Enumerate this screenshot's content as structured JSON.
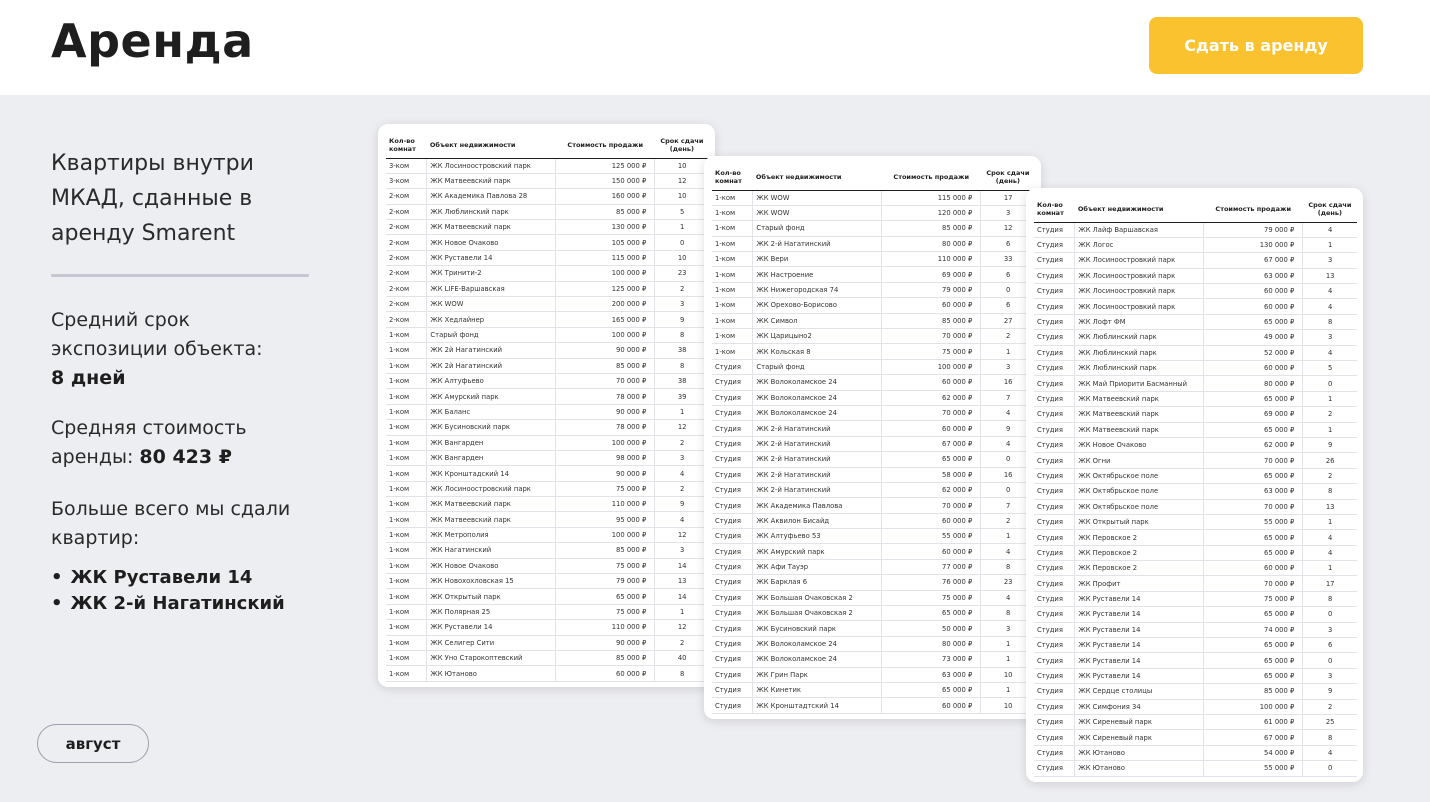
{
  "header": {
    "title": "Аренда",
    "cta_label": "Сдать в аренду"
  },
  "colors": {
    "accent": "#f9c22e",
    "background": "#edeef2",
    "text": "#1e1e1e"
  },
  "sidebar": {
    "headline": "Квартиры внутри МКАД, сданные в аренду Smarent",
    "exposure_label": "Средний срок экспозиции объекта:",
    "exposure_value": "8 дней",
    "avg_price_label": "Средняя стоимость аренды:",
    "avg_price_value": "80 423 ₽",
    "most_rented_label": "Больше всего мы сдали квартир:",
    "most_rented": [
      "ЖК Руставели 14",
      "ЖК 2-й Нагатинский"
    ],
    "month": "август"
  },
  "table_headers": [
    "Кол-во комнат",
    "Объект недвижимости",
    "Стоимость продажи",
    "Срок сдачи (день)"
  ],
  "tables": [
    [
      [
        "3-ком",
        "ЖК Лосиноостровский парк",
        "125 000 ₽",
        "10"
      ],
      [
        "3-ком",
        "ЖК Матвеевский парк",
        "150 000 ₽",
        "12"
      ],
      [
        "2-ком",
        "ЖК Академика Павлова 28",
        "160 000 ₽",
        "10"
      ],
      [
        "2-ком",
        "ЖК Люблинский парк",
        "85 000 ₽",
        "5"
      ],
      [
        "2-ком",
        "ЖК Матвеевский парк",
        "130 000 ₽",
        "1"
      ],
      [
        "2-ком",
        "ЖК Новое Очаково",
        "105 000 ₽",
        "0"
      ],
      [
        "2-ком",
        "ЖК Руставели 14",
        "115 000 ₽",
        "10"
      ],
      [
        "2-ком",
        "ЖК Тринити-2",
        "100 000 ₽",
        "23"
      ],
      [
        "2-ком",
        "ЖК LIFE-Варшавская",
        "125 000 ₽",
        "2"
      ],
      [
        "2-ком",
        "ЖК WOW",
        "200 000 ₽",
        "3"
      ],
      [
        "2-ком",
        "ЖК Хедлайнер",
        "165 000 ₽",
        "9"
      ],
      [
        "1-ком",
        "Старый фонд",
        "100 000 ₽",
        "8"
      ],
      [
        "1-ком",
        "ЖК 2й Нагатинский",
        "90 000 ₽",
        "38"
      ],
      [
        "1-ком",
        "ЖК 2й Нагатинский",
        "85 000 ₽",
        "8"
      ],
      [
        "1-ком",
        "ЖК Алтуфьево",
        "70 000 ₽",
        "38"
      ],
      [
        "1-ком",
        "ЖК Амурский парк",
        "78 000 ₽",
        "39"
      ],
      [
        "1-ком",
        "ЖК Баланс",
        "90 000 ₽",
        "1"
      ],
      [
        "1-ком",
        "ЖК Бусиновский парк",
        "78 000 ₽",
        "12"
      ],
      [
        "1-ком",
        "ЖК Вангарден",
        "100 000 ₽",
        "2"
      ],
      [
        "1-ком",
        "ЖК Вангарден",
        "98 000 ₽",
        "3"
      ],
      [
        "1-ком",
        "ЖК Кронштадский 14",
        "90 000 ₽",
        "4"
      ],
      [
        "1-ком",
        "ЖК Лосиноостровский парк",
        "75 000 ₽",
        "2"
      ],
      [
        "1-ком",
        "ЖК Матвеевский парк",
        "110 000 ₽",
        "9"
      ],
      [
        "1-ком",
        "ЖК Матвеевский парк",
        "95 000 ₽",
        "4"
      ],
      [
        "1-ком",
        "ЖК Метрополия",
        "100 000 ₽",
        "12"
      ],
      [
        "1-ком",
        "ЖК Нагатинский",
        "85 000 ₽",
        "3"
      ],
      [
        "1-ком",
        "ЖК Новое Очаково",
        "75 000 ₽",
        "14"
      ],
      [
        "1-ком",
        "ЖК Новохохловская 15",
        "79 000 ₽",
        "13"
      ],
      [
        "1-ком",
        "ЖК Открытый парк",
        "65 000 ₽",
        "14"
      ],
      [
        "1-ком",
        "ЖК Полярная 25",
        "75 000 ₽",
        "1"
      ],
      [
        "1-ком",
        "ЖК Руставели 14",
        "110 000 ₽",
        "12"
      ],
      [
        "1-ком",
        "ЖК Селигер Сити",
        "90 000 ₽",
        "2"
      ],
      [
        "1-ком",
        "ЖК Уно Старокоптевский",
        "85 000 ₽",
        "40"
      ],
      [
        "1-ком",
        "ЖК Ютаново",
        "60 000 ₽",
        "8"
      ]
    ],
    [
      [
        "1-ком",
        "ЖК WOW",
        "115 000 ₽",
        "17"
      ],
      [
        "1-ком",
        "ЖК WOW",
        "120 000 ₽",
        "3"
      ],
      [
        "1-ком",
        "Старый фонд",
        "85 000 ₽",
        "12"
      ],
      [
        "1-ком",
        "ЖК 2-й Нагатинский",
        "80 000 ₽",
        "6"
      ],
      [
        "1-ком",
        "ЖК Вери",
        "110 000 ₽",
        "33"
      ],
      [
        "1-ком",
        "ЖК Настроение",
        "69 000 ₽",
        "6"
      ],
      [
        "1-ком",
        "ЖК Нижегородская 74",
        "79 000 ₽",
        "0"
      ],
      [
        "1-ком",
        "ЖК Орехово-Борисово",
        "60 000 ₽",
        "6"
      ],
      [
        "1-ком",
        "ЖК Символ",
        "85 000 ₽",
        "27"
      ],
      [
        "1-ком",
        "ЖК Царицыно2",
        "70 000 ₽",
        "2"
      ],
      [
        "1-ком",
        "ЖК Кольская 8",
        "75 000 ₽",
        "1"
      ],
      [
        "Студия",
        "Старый фонд",
        "100 000 ₽",
        "3"
      ],
      [
        "Студия",
        "ЖК Волоколамское 24",
        "60 000 ₽",
        "16"
      ],
      [
        "Студия",
        "ЖК Волоколамское 24",
        "62 000 ₽",
        "7"
      ],
      [
        "Студия",
        "ЖК Волоколамское 24",
        "70 000 ₽",
        "4"
      ],
      [
        "Студия",
        "ЖК 2-й Нагатинский",
        "60 000 ₽",
        "9"
      ],
      [
        "Студия",
        "ЖК 2-й Нагатинский",
        "67 000 ₽",
        "4"
      ],
      [
        "Студия",
        "ЖК 2-й Нагатинский",
        "65 000 ₽",
        "0"
      ],
      [
        "Студия",
        "ЖК 2-й Нагатинский",
        "58 000 ₽",
        "16"
      ],
      [
        "Студия",
        "ЖК 2-й Нагатинский",
        "62 000 ₽",
        "0"
      ],
      [
        "Студия",
        "ЖК Академика Павлова",
        "70 000 ₽",
        "7"
      ],
      [
        "Студия",
        "ЖК Аквилон Бисайд",
        "60 000 ₽",
        "2"
      ],
      [
        "Студия",
        "ЖК Алтуфьево 53",
        "55 000 ₽",
        "1"
      ],
      [
        "Студия",
        "ЖК Амурский парк",
        "60 000 ₽",
        "4"
      ],
      [
        "Студия",
        "ЖК Афи Тауэр",
        "77 000 ₽",
        "8"
      ],
      [
        "Студия",
        "ЖК Барклая 6",
        "76 000 ₽",
        "23"
      ],
      [
        "Студия",
        "ЖК Большая Очаковская 2",
        "75 000 ₽",
        "4"
      ],
      [
        "Студия",
        "ЖК Большая Очаковская 2",
        "65 000 ₽",
        "8"
      ],
      [
        "Студия",
        "ЖК Бусиновский парк",
        "50 000 ₽",
        "3"
      ],
      [
        "Студия",
        "ЖК Волоколамское 24",
        "80 000 ₽",
        "1"
      ],
      [
        "Студия",
        "ЖК Волоколамское 24",
        "73 000 ₽",
        "1"
      ],
      [
        "Студия",
        "ЖК Грин Парк",
        "63 000 ₽",
        "10"
      ],
      [
        "Студия",
        "ЖК Кинетик",
        "65 000 ₽",
        "1"
      ],
      [
        "Студия",
        "ЖК Кронштадтский 14",
        "60 000 ₽",
        "10"
      ]
    ],
    [
      [
        "Студия",
        "ЖК Лайф Варшавская",
        "79 000 ₽",
        "4"
      ],
      [
        "Студия",
        "ЖК Логос",
        "130 000 ₽",
        "1"
      ],
      [
        "Студия",
        "ЖК Лосиноостровкий парк",
        "67 000 ₽",
        "3"
      ],
      [
        "Студия",
        "ЖК Лосиноостровкий парк",
        "63 000 ₽",
        "13"
      ],
      [
        "Студия",
        "ЖК Лосиноостровкий парк",
        "60 000 ₽",
        "4"
      ],
      [
        "Студия",
        "ЖК Лосиноостровкий парк",
        "60 000 ₽",
        "4"
      ],
      [
        "Студия",
        "ЖК Лофт ФМ",
        "65 000 ₽",
        "8"
      ],
      [
        "Студия",
        "ЖК Люблинский парк",
        "49 000 ₽",
        "3"
      ],
      [
        "Студия",
        "ЖК Люблинский парк",
        "52 000 ₽",
        "4"
      ],
      [
        "Студия",
        "ЖК Люблинский парк",
        "60 000 ₽",
        "5"
      ],
      [
        "Студия",
        "ЖК Май Приорити Басманный",
        "80 000 ₽",
        "0"
      ],
      [
        "Студия",
        "ЖК Матвеевский парк",
        "65 000 ₽",
        "1"
      ],
      [
        "Студия",
        "ЖК Матвеевский парк",
        "69 000 ₽",
        "2"
      ],
      [
        "Студия",
        "ЖК Матвеевский парк",
        "65 000 ₽",
        "1"
      ],
      [
        "Студия",
        "ЖК Новое Очаково",
        "62 000 ₽",
        "9"
      ],
      [
        "Студия",
        "ЖК Огни",
        "70 000 ₽",
        "26"
      ],
      [
        "Студия",
        "ЖК Октябрьское поле",
        "65 000 ₽",
        "2"
      ],
      [
        "Студия",
        "ЖК Октябрьское поле",
        "63 000 ₽",
        "8"
      ],
      [
        "Студия",
        "ЖК Октябрьское поле",
        "70 000 ₽",
        "13"
      ],
      [
        "Студия",
        "ЖК Открытый парк",
        "55 000 ₽",
        "1"
      ],
      [
        "Студия",
        "ЖК Перовское 2",
        "65 000 ₽",
        "4"
      ],
      [
        "Студия",
        "ЖК Перовское 2",
        "65 000 ₽",
        "4"
      ],
      [
        "Студия",
        "ЖК Перовское 2",
        "60 000 ₽",
        "1"
      ],
      [
        "Студия",
        "ЖК Профит",
        "70 000 ₽",
        "17"
      ],
      [
        "Студия",
        "ЖК Руставели 14",
        "75 000 ₽",
        "8"
      ],
      [
        "Студия",
        "ЖК Руставели 14",
        "65 000 ₽",
        "0"
      ],
      [
        "Студия",
        "ЖК Руставели 14",
        "74 000 ₽",
        "3"
      ],
      [
        "Студия",
        "ЖК Руставели 14",
        "65 000 ₽",
        "6"
      ],
      [
        "Студия",
        "ЖК Руставели 14",
        "65 000 ₽",
        "0"
      ],
      [
        "Студия",
        "ЖК Руставели 14",
        "65 000 ₽",
        "3"
      ],
      [
        "Студия",
        "ЖК Сердце столицы",
        "85 000 ₽",
        "9"
      ],
      [
        "Студия",
        "ЖК Симфония 34",
        "100 000 ₽",
        "2"
      ],
      [
        "Студия",
        "ЖК Сиреневый парк",
        "61 000 ₽",
        "25"
      ],
      [
        "Студия",
        "ЖК Сиреневый парк",
        "67 000 ₽",
        "8"
      ],
      [
        "Студия",
        "ЖК Ютаново",
        "54 000 ₽",
        "4"
      ],
      [
        "Студия",
        "ЖК Ютаново",
        "55 000 ₽",
        "0"
      ]
    ]
  ]
}
